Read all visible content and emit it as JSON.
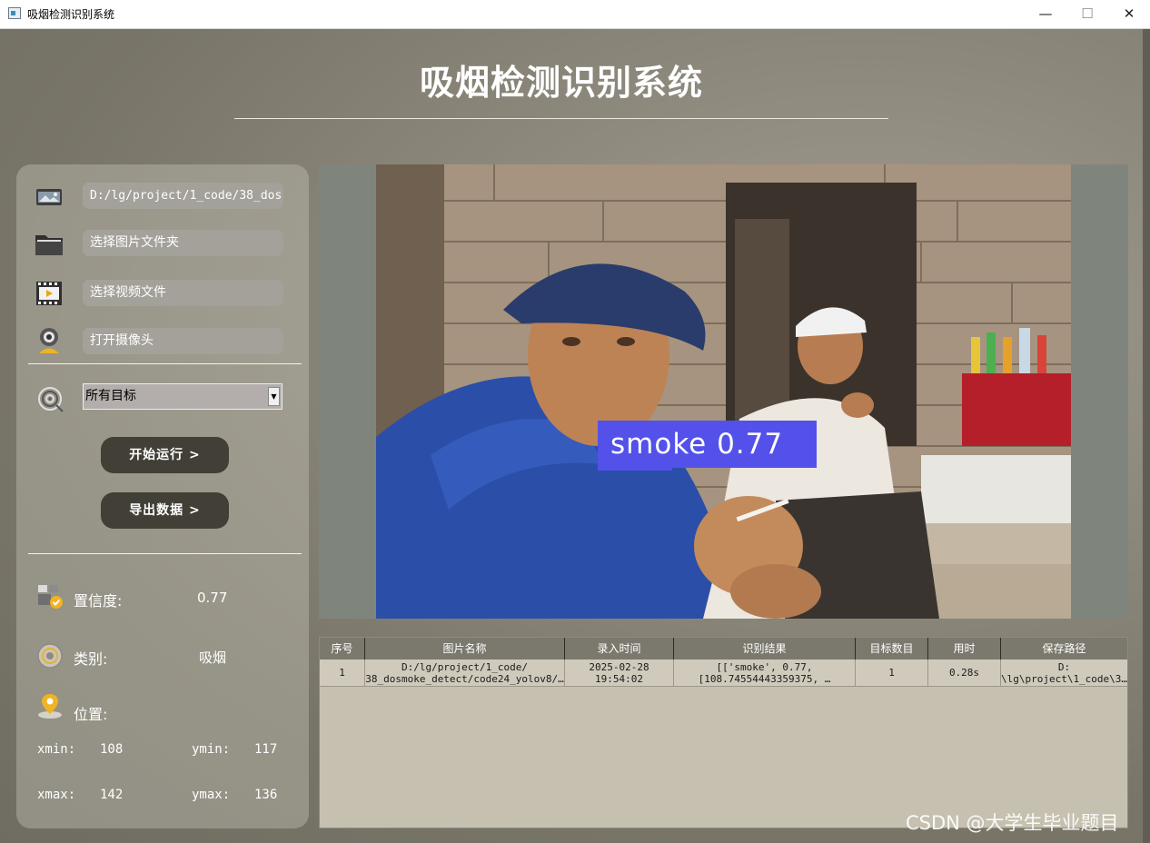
{
  "window": {
    "title": "吸烟检测识别系统",
    "controls": {
      "minimize": "—",
      "maximize": "☐",
      "close": "✕"
    }
  },
  "app_title": "吸烟检测识别系统",
  "left_panel": {
    "image_path": "D:/lg/project/1_code/38_dos",
    "select_folder_label": "选择图片文件夹",
    "select_video_label": "选择视频文件",
    "open_camera_label": "打开摄像头",
    "target_selected": "所有目标",
    "start_button": "开始运行 >",
    "export_button": "导出数据 >",
    "confidence_label": "置信度:",
    "confidence_value": "0.77",
    "category_label": "类别:",
    "category_value": "吸烟",
    "position_label": "位置:",
    "xmin_label": "xmin:",
    "xmin_value": "108",
    "ymin_label": "ymin:",
    "ymin_value": "117",
    "xmax_label": "xmax:",
    "xmax_value": "142",
    "ymax_label": "ymax:",
    "ymax_value": "136"
  },
  "detection": {
    "label": "smoke 0.77",
    "color": "#5351ea"
  },
  "table": {
    "headers": [
      "序号",
      "图片名称",
      "录入时间",
      "识别结果",
      "目标数目",
      "用时",
      "保存路径"
    ],
    "rows": [
      {
        "index": "1",
        "name_line1": "D:/lg/project/1_code/",
        "name_line2": "38_dosmoke_detect/code24_yolov8/…",
        "time_line1": "2025-02-28",
        "time_line2": "19:54:02",
        "result_line1": "[['smoke', 0.77,",
        "result_line2": "[108.74554443359375, …",
        "count": "1",
        "duration": "0.28s",
        "path_line1": "D:",
        "path_line2": "\\lg\\project\\1_code\\3…"
      }
    ]
  },
  "watermark": "CSDN @大学生毕业题目"
}
